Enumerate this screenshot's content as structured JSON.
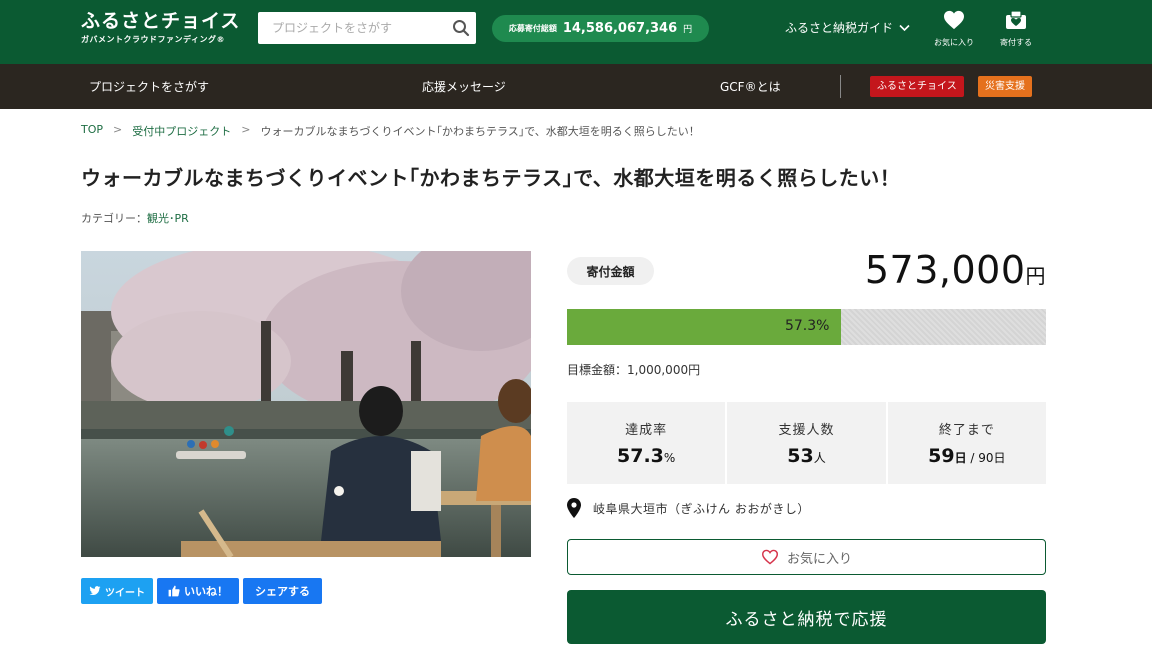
{
  "header": {
    "logo_main": "ふるさとチョイス",
    "logo_sub": "ガバメントクラウドファンディング®",
    "search_placeholder": "プロジェクトをさがす",
    "donation_total_label": "応募寄付総額",
    "donation_total_value": "14,586,067,346",
    "donation_total_unit": "円",
    "guide_label": "ふるさと納税ガイド",
    "favorites_label": "お気に入り",
    "donate_label": "寄付する"
  },
  "nav": {
    "find_projects": "プロジェクトをさがす",
    "messages": "応援メッセージ",
    "about_gcf": "GCF®とは",
    "badge_choice": "ふるさとチョイス",
    "badge_disaster": "災害支援",
    "badge_choice_color": "#c4161c",
    "badge_disaster_color": "#e5711d"
  },
  "breadcrumb": {
    "top": "TOP",
    "list": "受付中プロジェクト",
    "current": "ウォーカブルなまちづくりイベント｢かわまちテラス｣で、水都大垣を明るく照らしたい！",
    "separator": ">"
  },
  "project": {
    "title": "ウォーカブルなまちづくりイベント｢かわまちテラス｣で、水都大垣を明るく照らしたい！",
    "category_label": "カテゴリー：",
    "category_value": "観光･PR"
  },
  "share": {
    "tweet": "ツイート",
    "like": "いいね！",
    "share": "シェアする"
  },
  "funding": {
    "amount_label": "寄付金額",
    "amount_value": "573,000",
    "amount_unit": "円",
    "progress_percent": 57.3,
    "progress_text": "57.3%",
    "goal_label": "目標金額：",
    "goal_value": "1,000,000円"
  },
  "stats": {
    "rate_label": "達成率",
    "rate_value": "57.3",
    "rate_unit": "%",
    "supporters_label": "支援人数",
    "supporters_value": "53",
    "supporters_unit": "人",
    "remaining_label": "終了まで",
    "remaining_value": "59",
    "remaining_unit": "日",
    "remaining_total": " / 90日"
  },
  "location": "岐阜県大垣市（ぎふけん おおがきし）",
  "actions": {
    "favorite": "お気に入り",
    "support": "ふるさと納税で応援"
  },
  "colors": {
    "brand_green": "#0b5a32",
    "progress_green": "#6aaa3c",
    "pill_green": "#1f8a4f",
    "navbar": "#2b2620",
    "twitter_blue": "#1da1f2",
    "facebook_blue": "#1877f2"
  }
}
